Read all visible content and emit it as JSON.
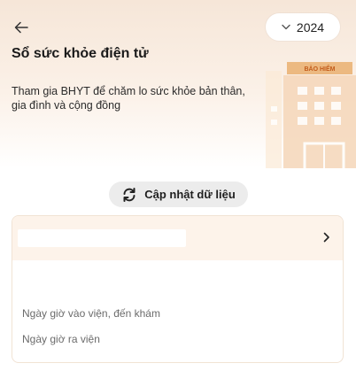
{
  "header": {
    "year": "2024",
    "title": "Sổ sức khỏe điện tử",
    "subtitle": "Tham gia BHYT để chăm lo sức khỏe bản thân, gia đình và cộng đồng",
    "illustration_sign": "BẢO HIỂM"
  },
  "actions": {
    "refresh_label": "Cập nhật dữ liệu"
  },
  "record_card": {
    "facility_name": "",
    "admission_label": "Ngày giờ vào viện, đến khám",
    "discharge_label": "Ngày giờ ra viện"
  },
  "icons": {
    "back": "arrow-left-icon",
    "year_dropdown": "chevron-down-icon",
    "refresh": "refresh-icon",
    "card_expand": "chevron-right-icon"
  },
  "colors": {
    "hero_bg": "#f6e6d8",
    "accent_orange": "#e8a24a",
    "card_header_bg": "#fdf3ea",
    "card_border": "#f1e3d4",
    "refresh_bg": "#ececec"
  }
}
